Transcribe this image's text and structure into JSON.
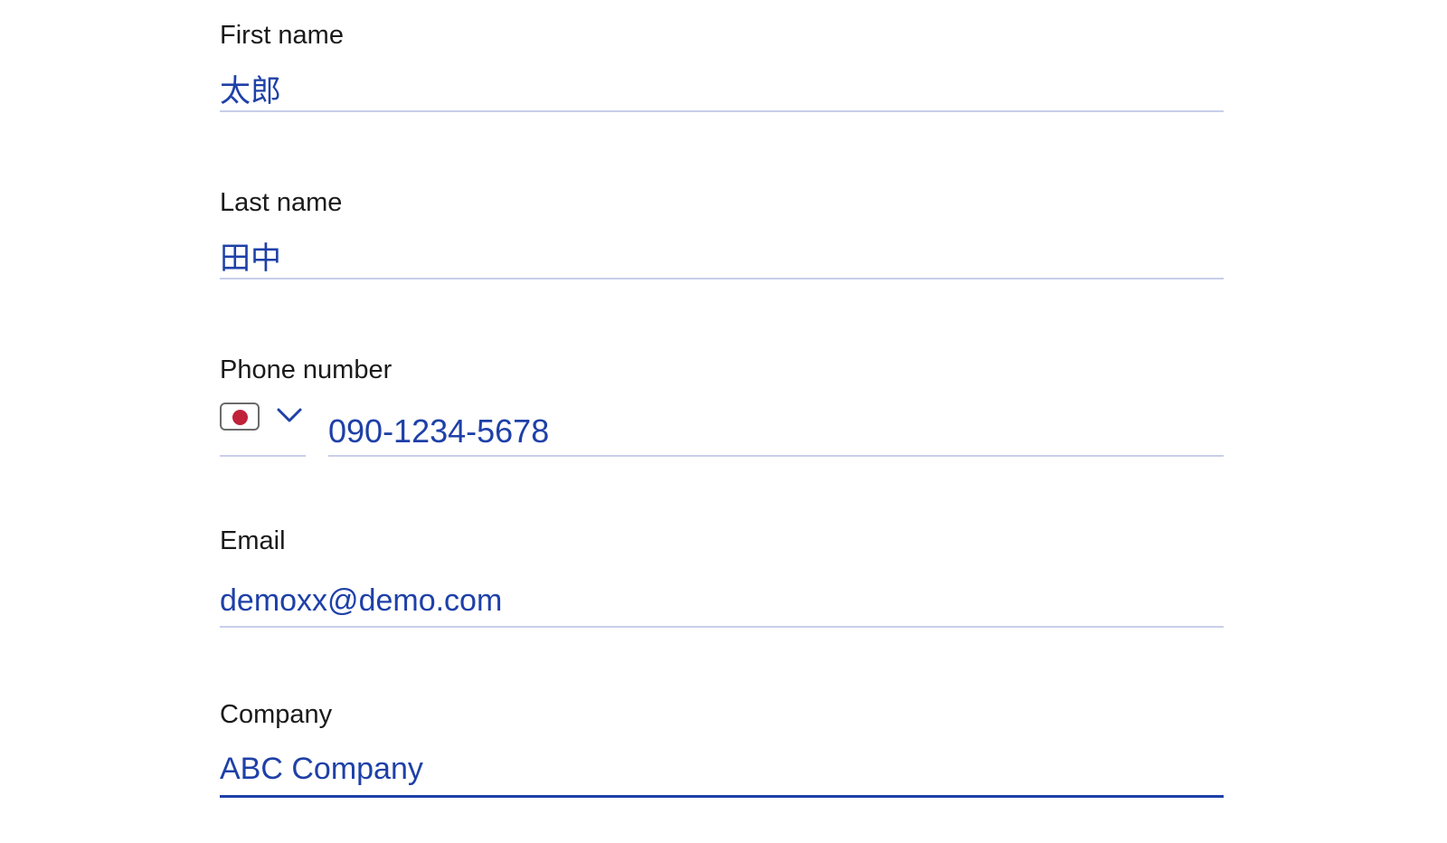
{
  "form": {
    "first_name": {
      "label": "First name",
      "value": "太郎"
    },
    "last_name": {
      "label": "Last name",
      "value": "田中"
    },
    "phone": {
      "label": "Phone number",
      "country_icon": "japan-flag-icon",
      "dropdown_icon": "chevron-down-icon",
      "value": "090-1234-5678"
    },
    "email": {
      "label": "Email",
      "value": "demoxx@demo.com"
    },
    "company": {
      "label": "Company",
      "value": "ABC Company"
    }
  },
  "colors": {
    "value_text": "#1e40a8",
    "underline": "#c8cfea",
    "focus_underline": "#1e40a8",
    "flag_red": "#c0223a"
  }
}
